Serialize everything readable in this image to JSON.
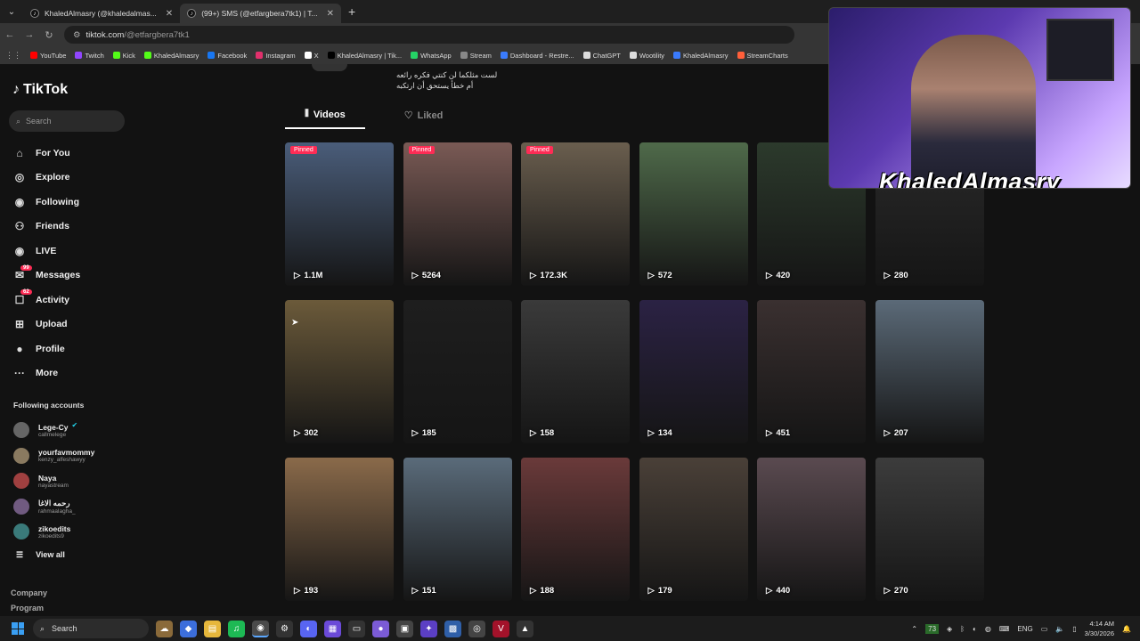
{
  "browser": {
    "tabs": [
      {
        "title": "KhaledAlmasry (@khaledalmas...",
        "active": false
      },
      {
        "title": "(99+) SMS (@etfargbera7tk1) | T...",
        "active": true
      }
    ],
    "url_host": "tiktok.com",
    "url_path": "/@etfargbera7tk1",
    "bookmarks": [
      {
        "label": "YouTube",
        "color": "#ff0000"
      },
      {
        "label": "Twitch",
        "color": "#9146ff"
      },
      {
        "label": "Kick",
        "color": "#53fc18"
      },
      {
        "label": "KhaledAlmasry",
        "color": "#53fc18"
      },
      {
        "label": "Facebook",
        "color": "#1877f2"
      },
      {
        "label": "Instagram",
        "color": "#e1306c"
      },
      {
        "label": "X",
        "color": "#ffffff"
      },
      {
        "label": "KhaledAlmasry | Tik...",
        "color": "#000000"
      },
      {
        "label": "WhatsApp",
        "color": "#25d366"
      },
      {
        "label": "Stream",
        "color": "#888888"
      },
      {
        "label": "Dashboard - Restre...",
        "color": "#3a7bfd"
      },
      {
        "label": "ChatGPT",
        "color": "#dddddd"
      },
      {
        "label": "Wootility",
        "color": "#dddddd"
      },
      {
        "label": "KhaledAlmasry",
        "color": "#3a7bfd"
      },
      {
        "label": "StreamCharts",
        "color": "#ff5f3a"
      }
    ]
  },
  "tiktok": {
    "logo": "TikTok",
    "search_placeholder": "Search",
    "nav": [
      {
        "label": "For You",
        "icon": "home-icon"
      },
      {
        "label": "Explore",
        "icon": "compass-icon"
      },
      {
        "label": "Following",
        "icon": "following-icon"
      },
      {
        "label": "Friends",
        "icon": "friends-icon"
      },
      {
        "label": "LIVE",
        "icon": "live-icon"
      },
      {
        "label": "Messages",
        "icon": "messages-icon",
        "badge": "99"
      },
      {
        "label": "Activity",
        "icon": "activity-icon",
        "badge": "62"
      },
      {
        "label": "Upload",
        "icon": "upload-icon"
      },
      {
        "label": "Profile",
        "icon": "profile-icon"
      },
      {
        "label": "More",
        "icon": "more-icon"
      }
    ],
    "following_title": "Following accounts",
    "accounts": [
      {
        "name": "Lege-Cy",
        "handle": "callmelege",
        "verified": true
      },
      {
        "name": "yourfavmommy",
        "handle": "kenzy_alfeshawyy"
      },
      {
        "name": "Naya",
        "handle": "nayastream"
      },
      {
        "name": "رحمه الاغا",
        "handle": "rahmaalagha_"
      },
      {
        "name": "zikoedits",
        "handle": "zikoedits9"
      }
    ],
    "view_all": "View all",
    "footer": [
      "Company",
      "Program"
    ],
    "bio": [
      "لست مثلكما لن كنتي فكره رائعه",
      "أم خطأ يستحق أن ارتكبه"
    ],
    "tabs": {
      "videos": "Videos",
      "liked": "Liked"
    },
    "pinned_label": "Pinned",
    "videos": [
      {
        "views": "1.1M",
        "pinned": true,
        "color": "#4a5d7a"
      },
      {
        "views": "5264",
        "pinned": true,
        "color": "#7a5a55"
      },
      {
        "views": "172.3K",
        "pinned": true,
        "color": "#6a5e4e"
      },
      {
        "views": "572",
        "pinned": false,
        "color": "#4f6a4a"
      },
      {
        "views": "420",
        "pinned": false,
        "color": "#2c3a2c"
      },
      {
        "views": "280",
        "pinned": false,
        "color": "#2a2a2a"
      },
      {
        "views": "302",
        "pinned": false,
        "color": "#6b5a3a"
      },
      {
        "views": "185",
        "pinned": false,
        "color": "#1e1e1e"
      },
      {
        "views": "158",
        "pinned": false,
        "color": "#3a3a3a"
      },
      {
        "views": "134",
        "pinned": false,
        "color": "#2b2244"
      },
      {
        "views": "451",
        "pinned": false,
        "color": "#3a3030"
      },
      {
        "views": "207",
        "pinned": false,
        "color": "#5b6a78"
      },
      {
        "views": "193",
        "pinned": false,
        "color": "#8a6a4a"
      },
      {
        "views": "151",
        "pinned": false,
        "color": "#5a6b7a"
      },
      {
        "views": "188",
        "pinned": false,
        "color": "#6a3a3a"
      },
      {
        "views": "179",
        "pinned": false,
        "color": "#4a4038"
      },
      {
        "views": "440",
        "pinned": false,
        "color": "#5a4a50"
      },
      {
        "views": "270",
        "pinned": false,
        "color": "#3c3c3c"
      }
    ]
  },
  "webcam": {
    "name": "KhaledAlmasry"
  },
  "taskbar": {
    "search_label": "Search",
    "temp": "73",
    "lang": "ENG",
    "time": "4:14 AM",
    "date": "3/30/2026"
  }
}
